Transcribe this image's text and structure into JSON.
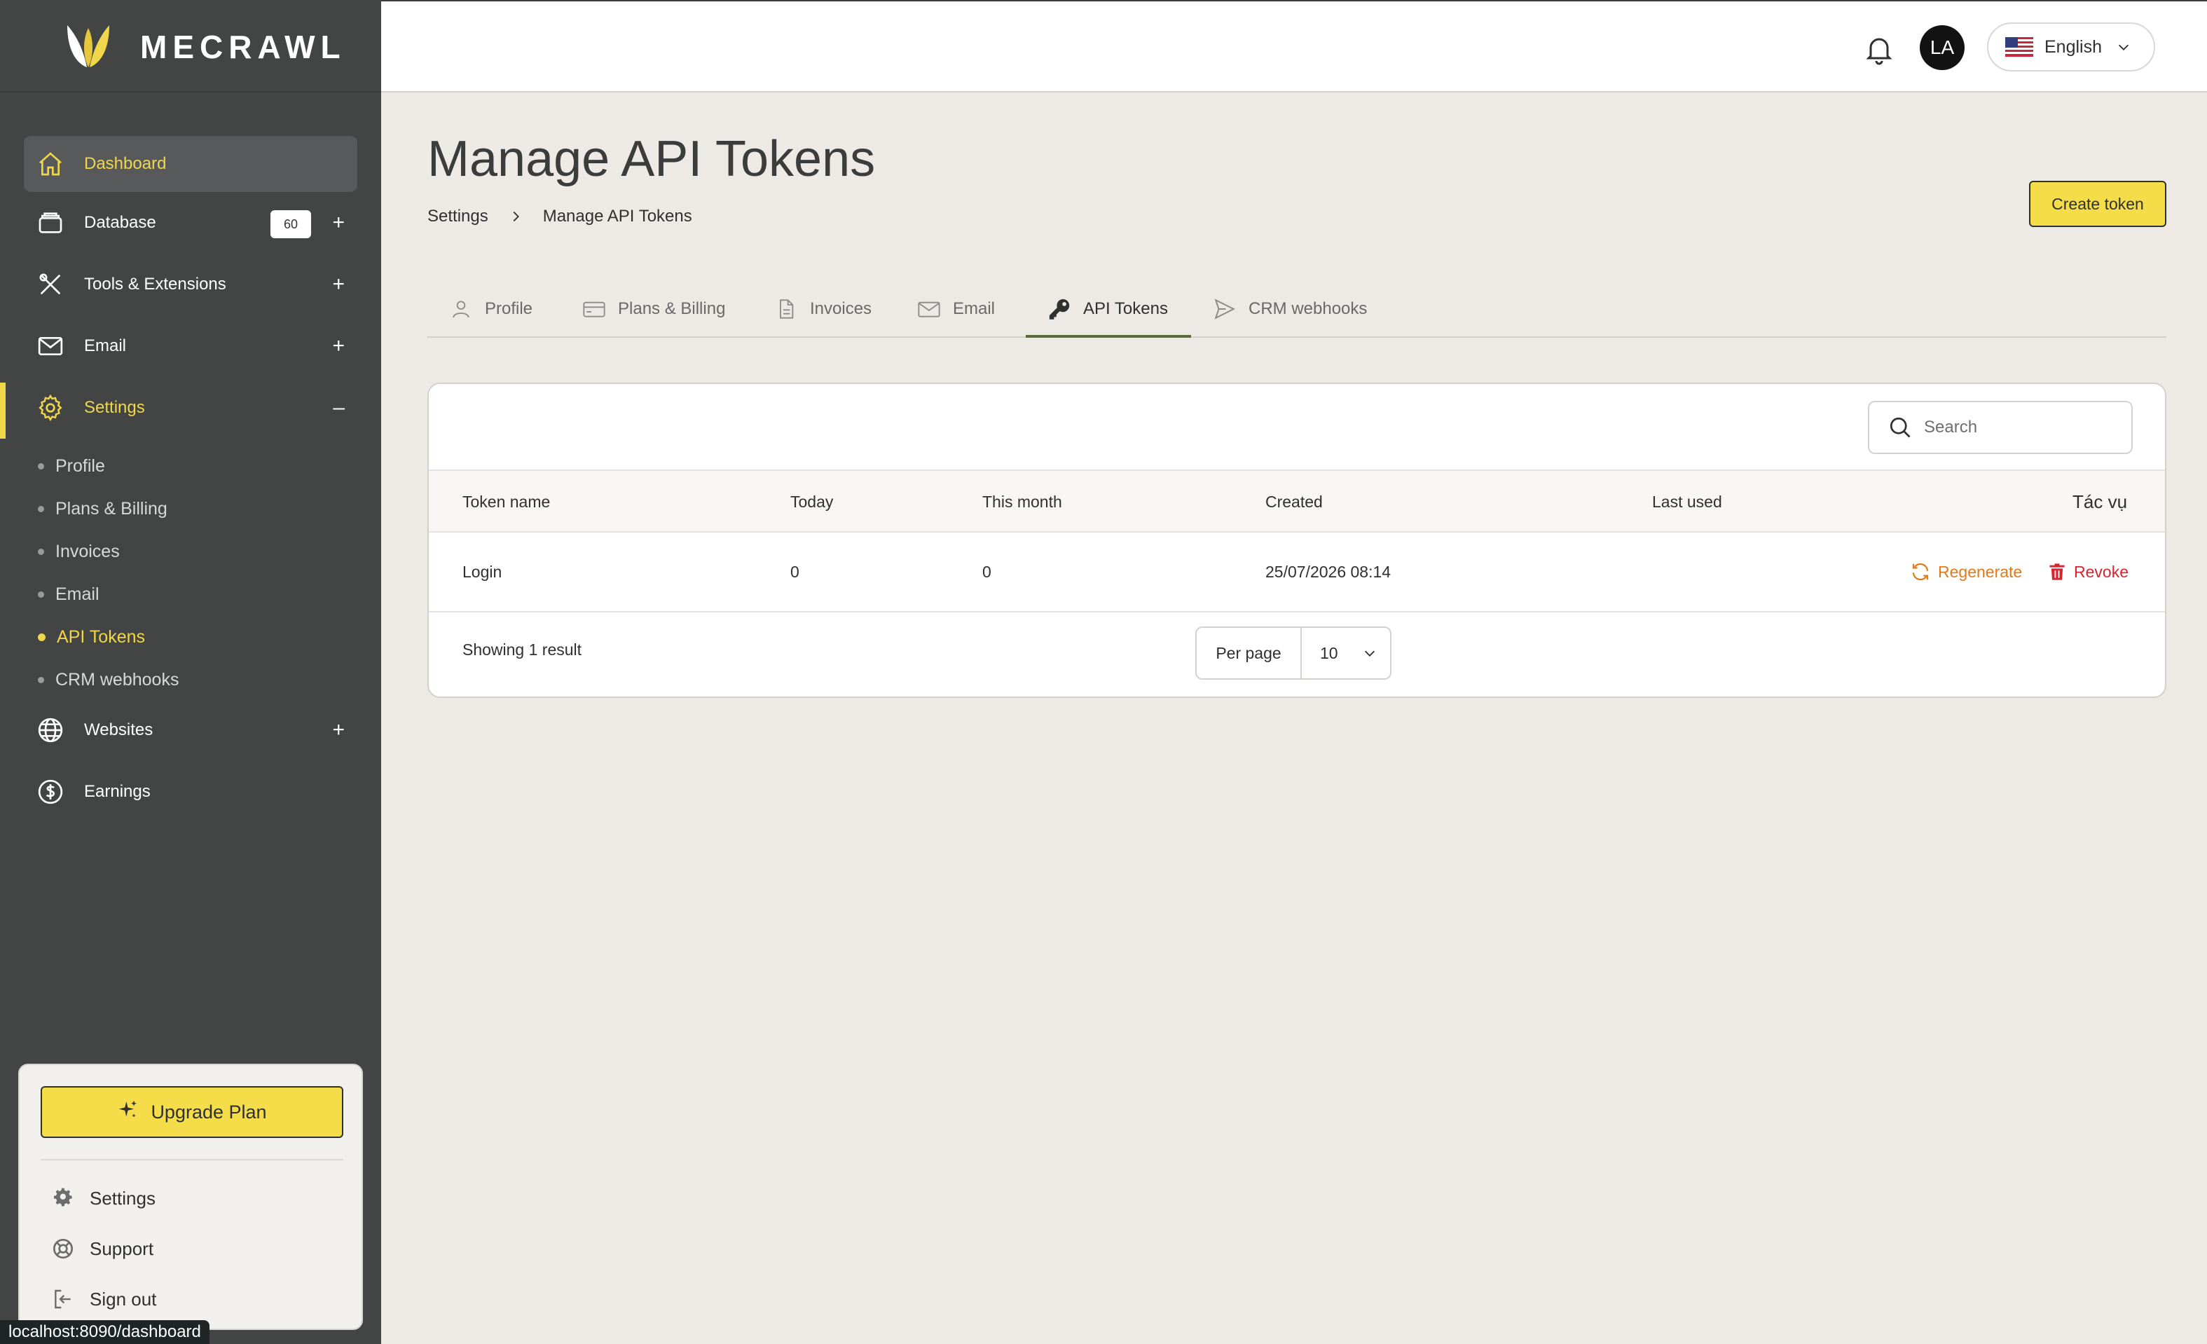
{
  "brand": {
    "name": "MECRAWL"
  },
  "sidebar": {
    "items": [
      {
        "label": "Dashboard",
        "icon": "home-icon"
      },
      {
        "label": "Database",
        "icon": "database-icon",
        "badge": "60",
        "toggle": "+"
      },
      {
        "label": "Tools & Extensions",
        "icon": "tools-icon",
        "toggle": "+"
      },
      {
        "label": "Email",
        "icon": "mail-icon",
        "toggle": "+"
      },
      {
        "label": "Settings",
        "icon": "gear-icon",
        "toggle": "–"
      },
      {
        "label": "Websites",
        "icon": "globe-icon",
        "toggle": "+"
      },
      {
        "label": "Earnings",
        "icon": "dollar-icon"
      }
    ],
    "settings_sub": [
      "Profile",
      "Plans & Billing",
      "Invoices",
      "Email",
      "API Tokens",
      "CRM webhooks"
    ],
    "bottom": {
      "upgrade_label": "Upgrade Plan",
      "settings_label": "Settings",
      "support_label": "Support",
      "signout_label": "Sign out"
    }
  },
  "status_bar": {
    "url": "localhost:8090/dashboard"
  },
  "topbar": {
    "avatar_initials": "LA",
    "language": "English"
  },
  "page": {
    "title": "Manage API Tokens",
    "breadcrumb": [
      "Settings",
      "Manage API Tokens"
    ],
    "create_label": "Create token"
  },
  "tabs": [
    {
      "label": "Profile",
      "icon": "user-icon"
    },
    {
      "label": "Plans & Billing",
      "icon": "card-icon"
    },
    {
      "label": "Invoices",
      "icon": "document-icon"
    },
    {
      "label": "Email",
      "icon": "mail-icon"
    },
    {
      "label": "API Tokens",
      "icon": "key-icon",
      "active": true
    },
    {
      "label": "CRM webhooks",
      "icon": "send-icon"
    }
  ],
  "table": {
    "search_placeholder": "Search",
    "columns": [
      "Token name",
      "Today",
      "This month",
      "Created",
      "Last used",
      "Tác vụ"
    ],
    "rows": [
      {
        "name": "Login",
        "today": "0",
        "month": "0",
        "created": "25/07/2026 08:14",
        "last_used": ""
      }
    ],
    "actions": {
      "regenerate": "Regenerate",
      "revoke": "Revoke"
    },
    "footer": {
      "showing": "Showing 1 result",
      "per_page_label": "Per page",
      "per_page_value": "10"
    }
  },
  "colors": {
    "accent": "#f5dd4a",
    "sidebar_bg": "#434544",
    "active_text": "#f0d64b",
    "regenerate": "#e07a1a",
    "revoke": "#d5252e"
  }
}
